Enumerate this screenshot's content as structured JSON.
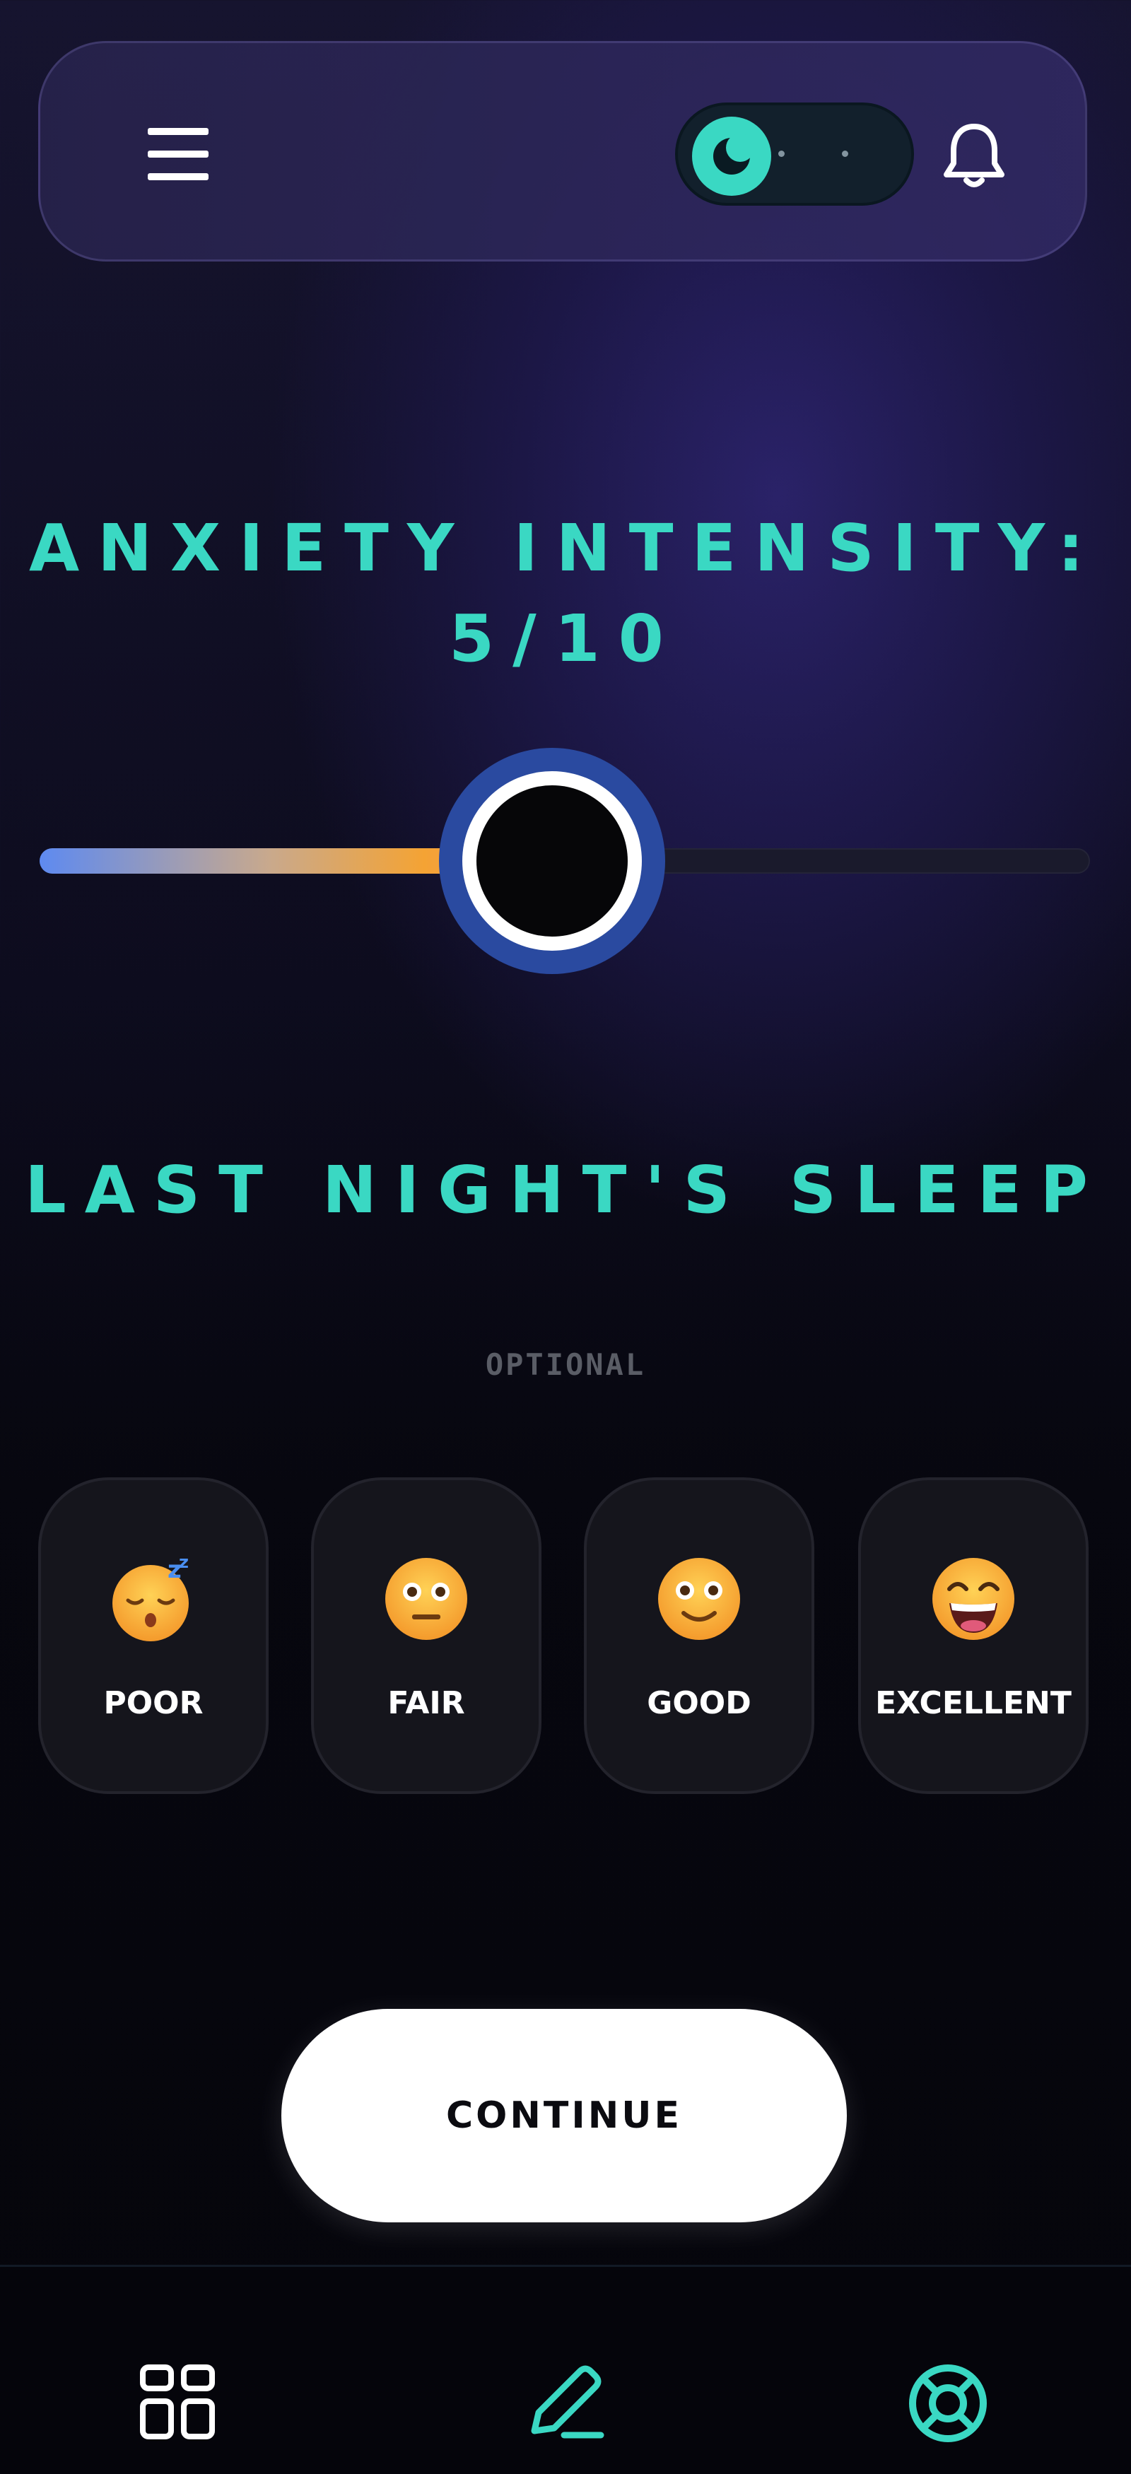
{
  "header": {
    "menu_icon": "hamburger-menu-icon",
    "theme_toggle_icon": "moon-icon",
    "bell_icon": "bell-icon"
  },
  "anxiety": {
    "heading": "ANXIETY INTENSITY: 5/10",
    "value": 5,
    "max": 10
  },
  "sleep": {
    "heading": "LAST NIGHT'S SLEEP",
    "optional_label": "OPTIONAL",
    "options": [
      {
        "label": "POOR",
        "icon": "sleeping-face-icon"
      },
      {
        "label": "FAIR",
        "icon": "neutral-face-icon"
      },
      {
        "label": "GOOD",
        "icon": "smiling-face-icon"
      },
      {
        "label": "EXCELLENT",
        "icon": "grinning-face-icon"
      }
    ]
  },
  "actions": {
    "continue_label": "CONTINUE"
  },
  "bottom_nav": {
    "items": [
      {
        "icon": "dashboard-grid-icon"
      },
      {
        "icon": "pencil-icon",
        "active": true
      },
      {
        "icon": "lifebuoy-icon"
      }
    ]
  },
  "colors": {
    "accent": "#3ad8c3",
    "thumb_ring": "#2a4aa0",
    "card_bg": "#15151c"
  }
}
